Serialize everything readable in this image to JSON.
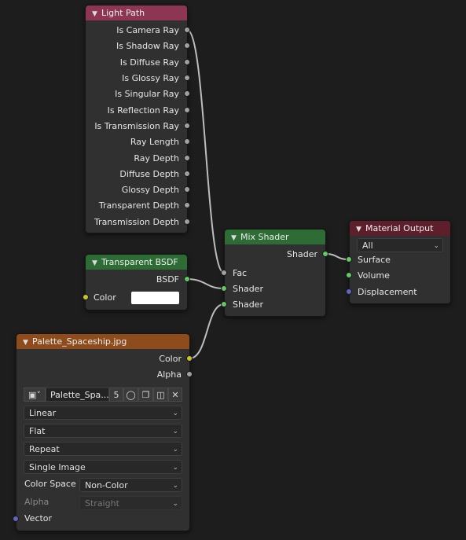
{
  "nodes": {
    "light_path": {
      "title": "Light Path",
      "outputs": [
        "Is Camera Ray",
        "Is Shadow Ray",
        "Is Diffuse Ray",
        "Is Glossy Ray",
        "Is Singular Ray",
        "Is Reflection Ray",
        "Is Transmission Ray",
        "Ray Length",
        "Ray Depth",
        "Diffuse Depth",
        "Glossy Depth",
        "Transparent Depth",
        "Transmission Depth"
      ]
    },
    "transparent_bsdf": {
      "title": "Transparent BSDF",
      "output": "BSDF",
      "input_color": "Color",
      "color_value": "#ffffff"
    },
    "mix_shader": {
      "title": "Mix Shader",
      "output": "Shader",
      "inputs": [
        "Fac",
        "Shader",
        "Shader"
      ]
    },
    "material_output": {
      "title": "Material Output",
      "target": "All",
      "inputs": [
        "Surface",
        "Volume",
        "Displacement"
      ]
    },
    "image_texture": {
      "title": "Palette_Spaceship.jpg",
      "outputs": [
        "Color",
        "Alpha"
      ],
      "image_name": "Palette_Spa...",
      "users": "5",
      "interpolation": "Linear",
      "projection": "Flat",
      "extension": "Repeat",
      "source": "Single Image",
      "color_space_label": "Color Space",
      "color_space": "Non-Color",
      "alpha_label": "Alpha",
      "alpha_mode": "Straight",
      "input_vector": "Vector"
    }
  },
  "colors": {
    "light_path_header": "#8c3654",
    "shader_header": "#2d6c34",
    "texture_header": "#8e4b1b",
    "output_header": "#5e1f2d",
    "socket_float": "#a1a1a1",
    "socket_shader": "#63c763",
    "socket_color": "#c7c729",
    "socket_vector": "#6363c7"
  }
}
